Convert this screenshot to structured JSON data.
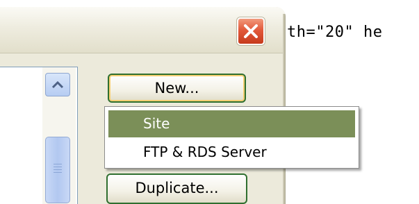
{
  "background_code": {
    "text": "th=\"20\" he"
  },
  "window": {
    "close_icon": "close-x-icon",
    "scrollbar": {
      "up_icon": "chevron-up-icon",
      "grip_icon": "grip-lines-icon"
    },
    "buttons": {
      "new_label": "New...",
      "duplicate_label": "Duplicate..."
    }
  },
  "menu": {
    "items": [
      {
        "label": "Site",
        "selected": true
      },
      {
        "label": "FTP & RDS Server",
        "selected": false
      }
    ]
  },
  "colors": {
    "menu_highlight": "#7b8f58",
    "button_border": "#2f6f2f",
    "close_red": "#e2593a",
    "scrollbar_blue": "#b6ccf2"
  }
}
